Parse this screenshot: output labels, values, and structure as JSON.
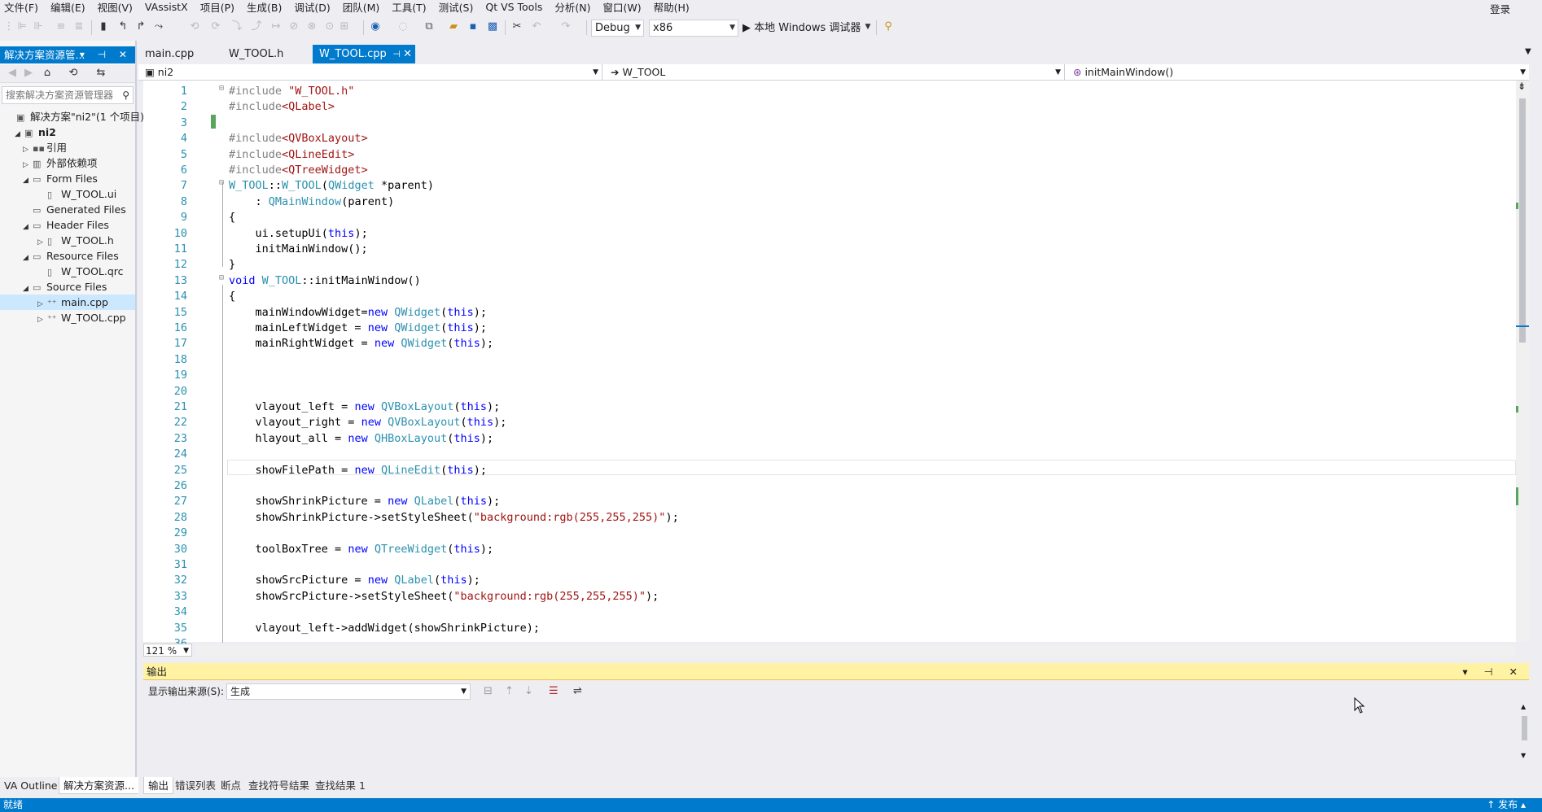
{
  "menu": [
    "文件(F)",
    "编辑(E)",
    "视图(V)",
    "VAssistX",
    "项目(P)",
    "生成(B)",
    "调试(D)",
    "团队(M)",
    "工具(T)",
    "测试(S)",
    "Qt VS Tools",
    "分析(N)",
    "窗口(W)",
    "帮助(H)"
  ],
  "login": "登录",
  "toolbar": {
    "config": "Debug",
    "platform": "x86",
    "debugger": "▶ 本地 Windows 调试器"
  },
  "solution_explorer": {
    "title": "解决方案资源管...",
    "title_buttons": "▾ ⊣ ✕",
    "search_placeholder": "搜索解决方案资源管理器",
    "items": [
      {
        "label": "解决方案\"ni2\"(1 个项目)",
        "icon": "solution-icon",
        "glyph": "▣",
        "exp": ""
      },
      {
        "label": "ni2",
        "icon": "project-icon",
        "glyph": "▣",
        "exp": "◢"
      },
      {
        "label": "引用",
        "icon": "references-icon",
        "glyph": "▪▪",
        "exp": "▷"
      },
      {
        "label": "外部依赖项",
        "icon": "dependencies-icon",
        "glyph": "▥",
        "exp": "▷"
      },
      {
        "label": "Form Files",
        "icon": "folder-icon",
        "glyph": "▭",
        "exp": "◢"
      },
      {
        "label": "W_TOOL.ui",
        "icon": "ui-file-icon",
        "glyph": "▯",
        "exp": ""
      },
      {
        "label": "Generated Files",
        "icon": "folder-icon",
        "glyph": "▭",
        "exp": ""
      },
      {
        "label": "Header Files",
        "icon": "folder-icon",
        "glyph": "▭",
        "exp": "◢"
      },
      {
        "label": "W_TOOL.h",
        "icon": "header-file-icon",
        "glyph": "▯",
        "exp": "▷"
      },
      {
        "label": "Resource Files",
        "icon": "folder-icon",
        "glyph": "▭",
        "exp": "◢"
      },
      {
        "label": "W_TOOL.qrc",
        "icon": "qrc-file-icon",
        "glyph": "▯",
        "exp": ""
      },
      {
        "label": "Source Files",
        "icon": "folder-icon",
        "glyph": "▭",
        "exp": "◢"
      },
      {
        "label": "main.cpp",
        "icon": "cpp-file-icon",
        "glyph": "⁺⁺",
        "exp": "▷"
      },
      {
        "label": "W_TOOL.cpp",
        "icon": "cpp-file-icon",
        "glyph": "⁺⁺",
        "exp": "▷"
      }
    ],
    "tabs": [
      "VA Outline",
      "解决方案资源..."
    ]
  },
  "doc_tabs": [
    {
      "label": "main.cpp"
    },
    {
      "label": "W_TOOL.h"
    },
    {
      "label": "W_TOOL.cpp"
    }
  ],
  "nav": {
    "project": "ni2",
    "class": "W_TOOL",
    "member": "initMainWindow()"
  },
  "editor": {
    "zoom": "121 %",
    "lines": [
      [
        {
          "c": "pp",
          "t": "#include "
        },
        {
          "c": "st",
          "t": "\"W_TOOL.h\""
        }
      ],
      [
        {
          "c": "pp",
          "t": "#include"
        },
        {
          "c": "st",
          "t": "<QLabel>"
        }
      ],
      [],
      [
        {
          "c": "pp",
          "t": "#include"
        },
        {
          "c": "st",
          "t": "<QVBoxLayout>"
        }
      ],
      [
        {
          "c": "pp",
          "t": "#include"
        },
        {
          "c": "st",
          "t": "<QLineEdit>"
        }
      ],
      [
        {
          "c": "pp",
          "t": "#include"
        },
        {
          "c": "st",
          "t": "<QTreeWidget>"
        }
      ],
      [
        {
          "c": "ty",
          "t": "W_TOOL"
        },
        {
          "c": "",
          "t": "::"
        },
        {
          "c": "ty",
          "t": "W_TOOL"
        },
        {
          "c": "",
          "t": "("
        },
        {
          "c": "ty",
          "t": "QWidget"
        },
        {
          "c": "",
          "t": " *parent)"
        }
      ],
      [
        {
          "c": "",
          "t": "    : "
        },
        {
          "c": "ty",
          "t": "QMainWindow"
        },
        {
          "c": "",
          "t": "(parent)"
        }
      ],
      [
        {
          "c": "",
          "t": "{"
        }
      ],
      [
        {
          "c": "",
          "t": "    ui.setupUi("
        },
        {
          "c": "kw",
          "t": "this"
        },
        {
          "c": "",
          "t": ");"
        }
      ],
      [
        {
          "c": "",
          "t": "    initMainWindow();"
        }
      ],
      [
        {
          "c": "",
          "t": "}"
        }
      ],
      [
        {
          "c": "kw",
          "t": "void "
        },
        {
          "c": "ty",
          "t": "W_TOOL"
        },
        {
          "c": "",
          "t": "::initMainWindow()"
        }
      ],
      [
        {
          "c": "",
          "t": "{"
        }
      ],
      [
        {
          "c": "",
          "t": "    mainWindowWidget="
        },
        {
          "c": "kw",
          "t": "new "
        },
        {
          "c": "ty",
          "t": "QWidget"
        },
        {
          "c": "",
          "t": "("
        },
        {
          "c": "kw",
          "t": "this"
        },
        {
          "c": "",
          "t": ");"
        }
      ],
      [
        {
          "c": "",
          "t": "    mainLeftWidget = "
        },
        {
          "c": "kw",
          "t": "new "
        },
        {
          "c": "ty",
          "t": "QWidget"
        },
        {
          "c": "",
          "t": "("
        },
        {
          "c": "kw",
          "t": "this"
        },
        {
          "c": "",
          "t": ");"
        }
      ],
      [
        {
          "c": "",
          "t": "    mainRightWidget = "
        },
        {
          "c": "kw",
          "t": "new "
        },
        {
          "c": "ty",
          "t": "QWidget"
        },
        {
          "c": "",
          "t": "("
        },
        {
          "c": "kw",
          "t": "this"
        },
        {
          "c": "",
          "t": ");"
        }
      ],
      [],
      [],
      [],
      [
        {
          "c": "",
          "t": "    vlayout_left = "
        },
        {
          "c": "kw",
          "t": "new "
        },
        {
          "c": "ty",
          "t": "QVBoxLayout"
        },
        {
          "c": "",
          "t": "("
        },
        {
          "c": "kw",
          "t": "this"
        },
        {
          "c": "",
          "t": ");"
        }
      ],
      [
        {
          "c": "",
          "t": "    vlayout_right = "
        },
        {
          "c": "kw",
          "t": "new "
        },
        {
          "c": "ty",
          "t": "QVBoxLayout"
        },
        {
          "c": "",
          "t": "("
        },
        {
          "c": "kw",
          "t": "this"
        },
        {
          "c": "",
          "t": ");"
        }
      ],
      [
        {
          "c": "",
          "t": "    hlayout_all = "
        },
        {
          "c": "kw",
          "t": "new "
        },
        {
          "c": "ty",
          "t": "QHBoxLayout"
        },
        {
          "c": "",
          "t": "("
        },
        {
          "c": "kw",
          "t": "this"
        },
        {
          "c": "",
          "t": ");"
        }
      ],
      [],
      [
        {
          "c": "",
          "t": "    showFilePath = "
        },
        {
          "c": "kw",
          "t": "new "
        },
        {
          "c": "ty",
          "t": "QLineEdit"
        },
        {
          "c": "",
          "t": "("
        },
        {
          "c": "kw",
          "t": "this"
        },
        {
          "c": "",
          "t": ");"
        }
      ],
      [],
      [
        {
          "c": "",
          "t": "    showShrinkPicture = "
        },
        {
          "c": "kw",
          "t": "new "
        },
        {
          "c": "ty",
          "t": "QLabel"
        },
        {
          "c": "",
          "t": "("
        },
        {
          "c": "kw",
          "t": "this"
        },
        {
          "c": "",
          "t": ");"
        }
      ],
      [
        {
          "c": "",
          "t": "    showShrinkPicture->setStyleSheet("
        },
        {
          "c": "st",
          "t": "\"background:rgb(255,255,255)\""
        },
        {
          "c": "",
          "t": ");"
        }
      ],
      [],
      [
        {
          "c": "",
          "t": "    toolBoxTree = "
        },
        {
          "c": "kw",
          "t": "new "
        },
        {
          "c": "ty",
          "t": "QTreeWidget"
        },
        {
          "c": "",
          "t": "("
        },
        {
          "c": "kw",
          "t": "this"
        },
        {
          "c": "",
          "t": ");"
        }
      ],
      [],
      [
        {
          "c": "",
          "t": "    showSrcPicture = "
        },
        {
          "c": "kw",
          "t": "new "
        },
        {
          "c": "ty",
          "t": "QLabel"
        },
        {
          "c": "",
          "t": "("
        },
        {
          "c": "kw",
          "t": "this"
        },
        {
          "c": "",
          "t": ");"
        }
      ],
      [
        {
          "c": "",
          "t": "    showSrcPicture->setStyleSheet("
        },
        {
          "c": "st",
          "t": "\"background:rgb(255,255,255)\""
        },
        {
          "c": "",
          "t": ");"
        }
      ],
      [],
      [
        {
          "c": "",
          "t": "    vlayout_left->addWidget(showShrinkPicture);"
        }
      ],
      [
        {
          "c": "",
          "t": "    vlayout_left->addWidget(toolBoxTree);"
        }
      ]
    ]
  },
  "output": {
    "title": "输出",
    "source_label": "显示输出来源(S):",
    "source_value": "生成",
    "tabs": [
      "输出",
      "错误列表",
      "断点",
      "查找符号结果",
      "查找结果 1"
    ]
  },
  "status": {
    "text": "就绪",
    "publish": "↑ 发布 ▴"
  },
  "colors": {
    "accent": "#007acc",
    "output_title": "#fff2a3",
    "change_marker": "#58a55c"
  }
}
